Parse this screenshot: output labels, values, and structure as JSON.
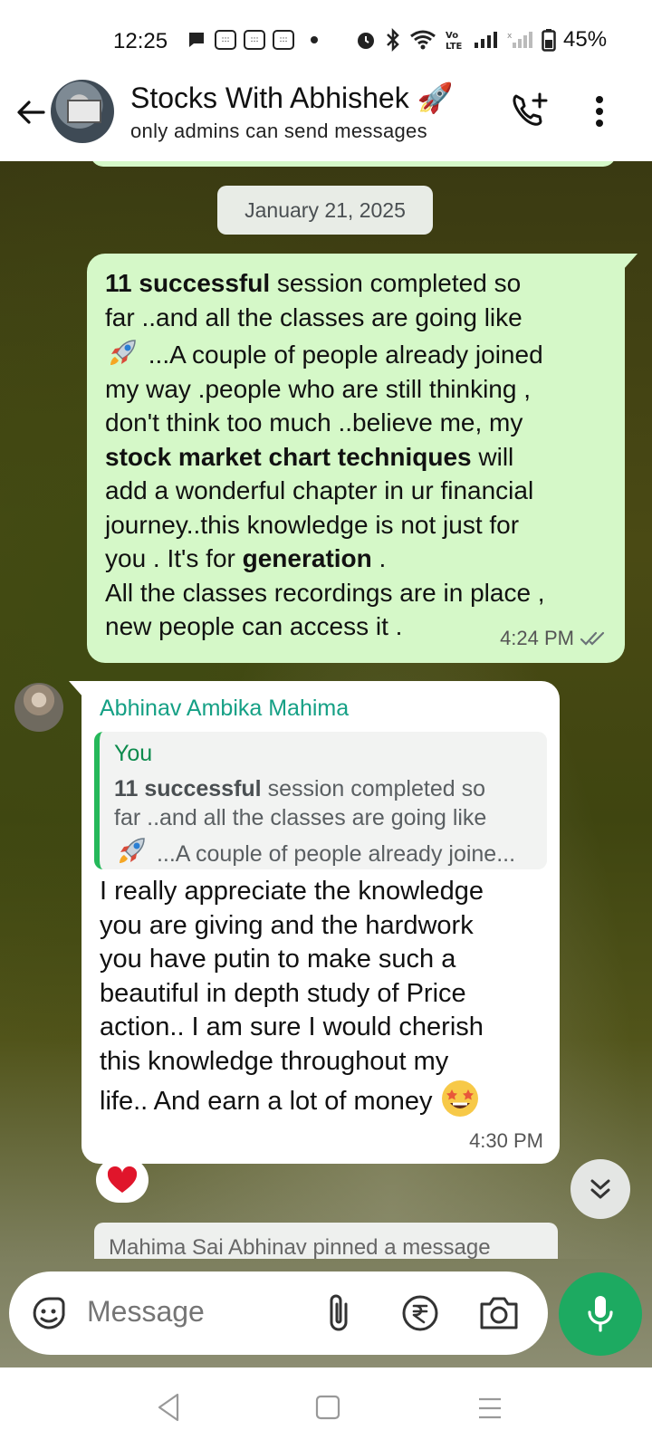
{
  "status_bar": {
    "time": "12:25",
    "battery": "45%"
  },
  "header": {
    "title": "Stocks With Abhishek 🚀",
    "subtitle": "only admins can send messages"
  },
  "chat": {
    "date_chip": "January 21, 2025",
    "outgoing": {
      "segments": [
        {
          "text": "11 successful",
          "bold": true
        },
        {
          "text": " session completed so\nfar ..and all the classes are going like\n",
          "bold": false
        },
        {
          "emoji": "rocket"
        },
        {
          "text": " ...A couple of people already joined\nmy way .people who are still thinking ,\ndon't think too much ..believe me, my\n",
          "bold": false
        },
        {
          "text": "stock market chart techniques",
          "bold": true
        },
        {
          "text": " will\nadd a wonderful chapter in ur financial\njourney..this knowledge is not just for\nyou . It's for ",
          "bold": false
        },
        {
          "text": "generation",
          "bold": true
        },
        {
          "text": " .\nAll the classes recordings are in place ,\nnew people can access it .",
          "bold": false
        }
      ],
      "time": "4:24 PM"
    },
    "incoming": {
      "sender": "Abhinav Ambika Mahima",
      "quote_author": "You",
      "quote_segments": [
        {
          "text": "11 successful",
          "bold": true
        },
        {
          "text": " session completed so\nfar ..and all the classes are going like\n",
          "bold": false
        },
        {
          "emoji": "rocket"
        },
        {
          "text": " ...A couple of people already joine...",
          "bold": false
        }
      ],
      "body": "I really appreciate the knowledge\nyou are giving and the hardwork\nyou have putin to make such a\nbeautiful in depth study of Price\naction.. I am sure I would cherish\nthis knowledge throughout my\nlife.. And earn a lot of money",
      "time": "4:30 PM",
      "reaction": "❤️"
    },
    "pinned_notice": "Mahima Sai Abhinav pinned a message"
  },
  "composer": {
    "placeholder": "Message"
  },
  "icons": {
    "back": "back-arrow-icon",
    "call": "add-call-icon",
    "menu": "more-vert-icon",
    "sticker": "sticker-icon",
    "attach": "paperclip-icon",
    "payment": "rupee-icon",
    "camera": "camera-icon",
    "mic": "mic-icon",
    "scroll": "double-chevron-down-icon"
  },
  "colors": {
    "outgoing_bubble": "#d5f8c8",
    "sender_name": "#15a085",
    "quote_bar": "#25b85a",
    "mic_button": "#1daa61"
  }
}
